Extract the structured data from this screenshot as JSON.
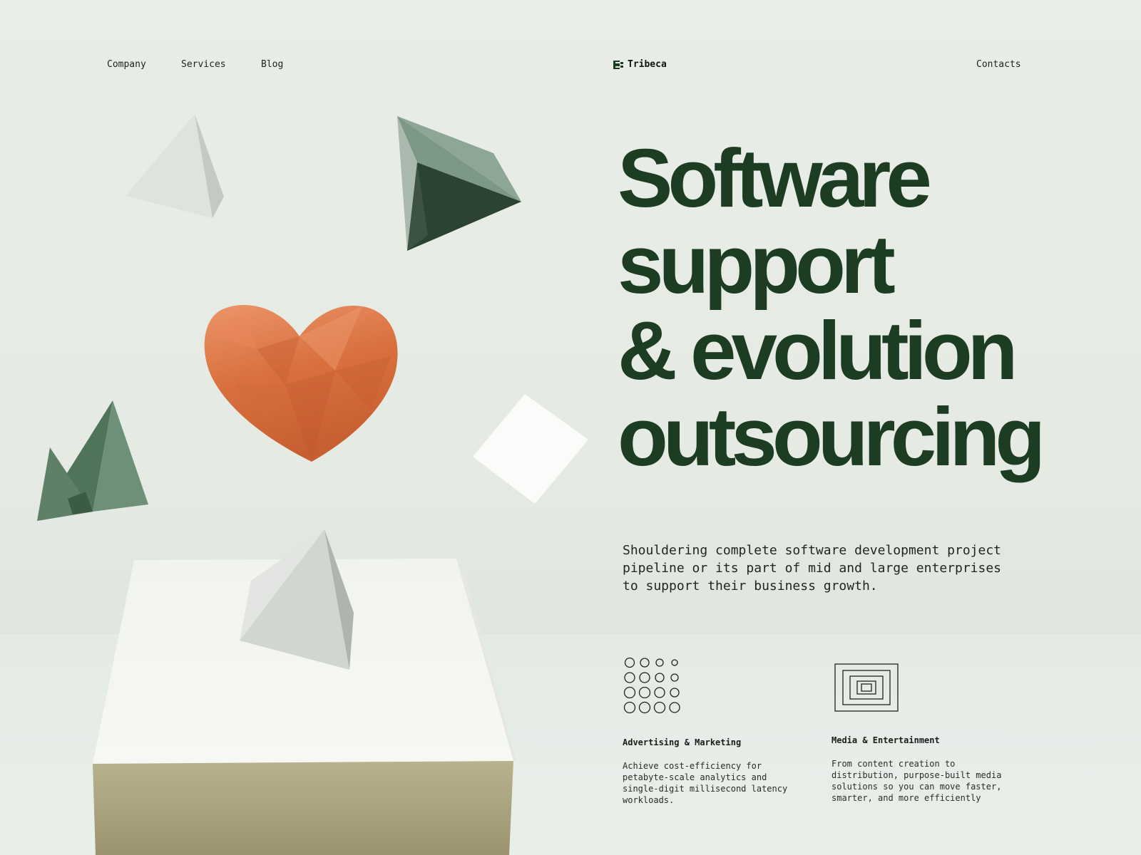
{
  "nav": {
    "links": [
      "Company",
      "Services",
      "Blog"
    ],
    "contacts": "Contacts"
  },
  "brand": {
    "name": "Tribeca",
    "icon": "tribeca-logo-icon"
  },
  "hero": {
    "title_lines": [
      "Software",
      "support",
      "& evolution",
      "outsourcing"
    ],
    "description": "Shouldering complete software development project pipeline or its part of mid and large enterprises to support their business growth."
  },
  "features": [
    {
      "icon": "dot-grid-icon",
      "title": "Advertising & Marketing",
      "description": "Achieve cost-efficiency for petabyte-scale analytics and single-digit millisecond latency workloads."
    },
    {
      "icon": "nested-squares-icon",
      "title": "Media & Entertainment",
      "description": "From content creation to distribution, purpose-built media solutions so you can move faster, smarter, and more efficiently"
    }
  ],
  "colors": {
    "heading": "#1c3d21",
    "background": "#e9ede7",
    "heart": "#d9703e",
    "pyramid_green": "#5a7d63"
  }
}
